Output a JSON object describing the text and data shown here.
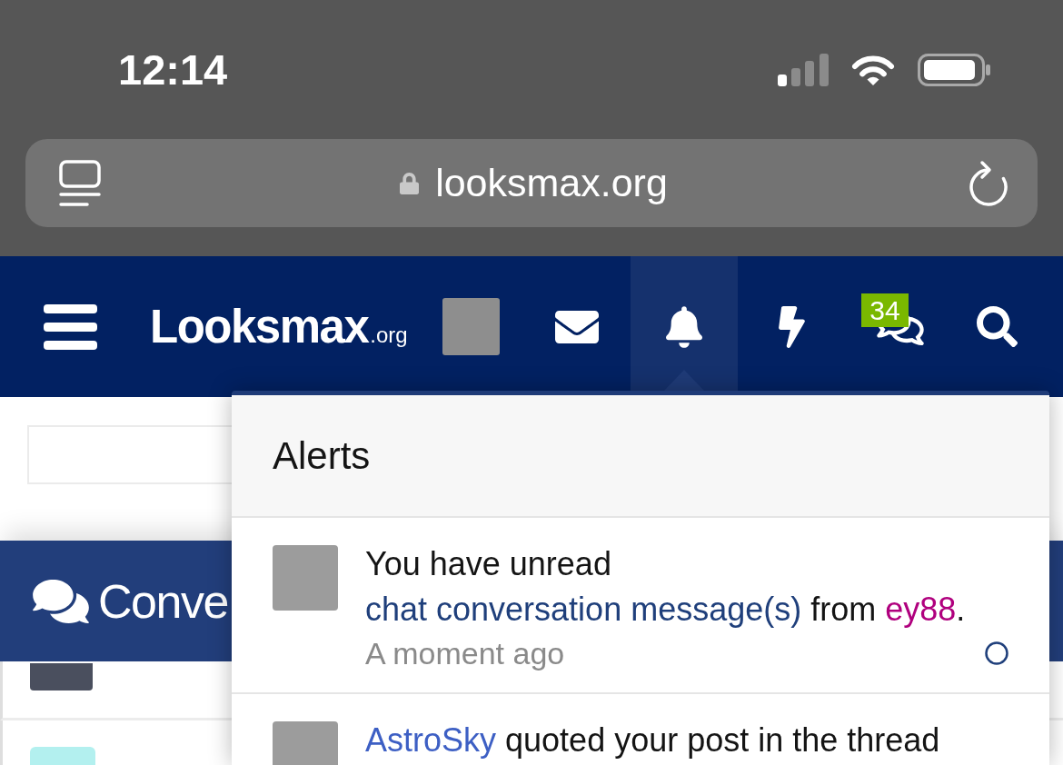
{
  "status_bar": {
    "time": "12:14"
  },
  "address_bar": {
    "url": "looksmax.org"
  },
  "header": {
    "logo": {
      "text": "Looksmax",
      "suffix": ".org"
    },
    "tabs": [
      {
        "kind": "account",
        "selected": false
      },
      {
        "kind": "inbox",
        "selected": false
      },
      {
        "kind": "alerts",
        "selected": true
      },
      {
        "kind": "whats_new",
        "selected": false
      },
      {
        "kind": "conversations",
        "selected": false,
        "badge": "34"
      },
      {
        "kind": "search",
        "selected": false
      }
    ]
  },
  "page": {
    "section_title": "Conve"
  },
  "alerts_menu": {
    "title": "Alerts",
    "items": [
      {
        "segments": [
          {
            "kind": "text",
            "text": "You have unread "
          },
          {
            "kind": "link",
            "text": "chat conversation message(s)"
          },
          {
            "kind": "text",
            "text": " from "
          },
          {
            "kind": "user",
            "text": "ey88",
            "color": "#b0007e"
          },
          {
            "kind": "text",
            "text": "."
          }
        ],
        "time": "A moment ago",
        "unread": true
      },
      {
        "segments": [
          {
            "kind": "user",
            "text": "AstroSky",
            "color": "#3d5fc4"
          },
          {
            "kind": "text",
            "text": " quoted your post in the thread"
          }
        ]
      }
    ]
  }
}
